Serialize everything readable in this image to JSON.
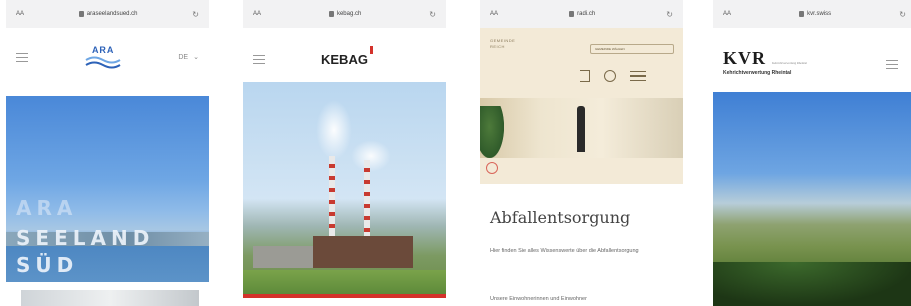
{
  "phones": [
    {
      "status_left": "AA",
      "url": "araseelandsued.ch",
      "logo_text": "ARA",
      "language": "DE",
      "hero_lines": [
        "ARA",
        "SEELAND",
        "SÜD"
      ]
    },
    {
      "status_left": "AA",
      "url": "kebag.ch",
      "logo_text": "KEBAG"
    },
    {
      "status_left": "AA",
      "url": "radi.ch",
      "logo_lines": [
        "GEMEINDE",
        "REICH"
      ],
      "select_label": "GEMEINDE WÄHLEN",
      "title": "Abfallentsorgung",
      "paragraph1": "Hier finden Sie alles Wissenswerte über die Abfallentsorgung",
      "paragraph2": "Unsere Einwohnerinnen und Einwohner"
    },
    {
      "status_left": "AA",
      "url": "kvr.swiss",
      "logo_text": "KVR",
      "logo_small": "Kehrichtverwertung Rheintal",
      "logo_subtitle": "Kehrichtverwertung Rheintal"
    }
  ],
  "colors": {
    "ara_blue": "#2d62b8",
    "kebag_red": "#d4322b",
    "gemeinde_beige": "#f3ead7"
  }
}
